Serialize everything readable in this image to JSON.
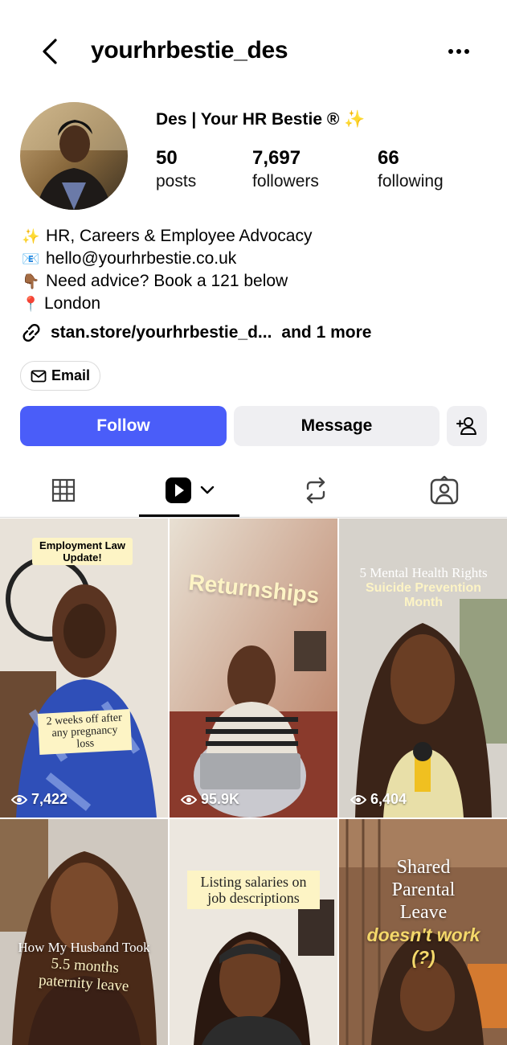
{
  "header": {
    "username": "yourhrbestie_des"
  },
  "profile": {
    "display_name": "Des | Your HR Bestie ®",
    "display_name_emoji": "✨",
    "stats": [
      {
        "value": "50",
        "label": "posts"
      },
      {
        "value": "7,697",
        "label": "followers"
      },
      {
        "value": "66",
        "label": "following"
      }
    ],
    "bio": [
      {
        "icon": "✨",
        "text": "HR, Careers & Employee Advocacy"
      },
      {
        "icon": "📧",
        "text": "hello@yourhrbestie.co.uk"
      },
      {
        "icon": "👇🏾",
        "text": "Need advice? Book a 121 below"
      },
      {
        "icon": "📍",
        "text": "London"
      }
    ],
    "link": {
      "url": "stan.store/yourhrbestie_d...",
      "more": "and 1 more"
    },
    "email_button": "Email"
  },
  "actions": {
    "follow": "Follow",
    "message": "Message"
  },
  "tabs": [
    {
      "name": "grid-tab",
      "icon": "grid-icon"
    },
    {
      "name": "reels-tab",
      "icon": "reels-icon",
      "active": true
    },
    {
      "name": "reposts-tab",
      "icon": "repost-icon"
    },
    {
      "name": "tagged-tab",
      "icon": "tagged-user-icon"
    }
  ],
  "posts": [
    {
      "caption": "Employment Law Update!",
      "caption2": "2 weeks off after any pregnancy loss",
      "views": "7,422"
    },
    {
      "caption": "Returnships",
      "views": "95.9K"
    },
    {
      "caption": "5 Mental Health Rights",
      "caption2": "Suicide Prevention Month",
      "views": "6,404"
    },
    {
      "caption": "How My Husband Took",
      "caption2": "5.5 months paternity leave"
    },
    {
      "caption": "Listing salaries on job descriptions"
    },
    {
      "caption": "Shared Parental Leave",
      "caption2": "doesn't work (?)"
    }
  ],
  "colors": {
    "accent": "#4a5df9",
    "secondary_button": "#efeff2",
    "border": "#dbdbdb"
  }
}
